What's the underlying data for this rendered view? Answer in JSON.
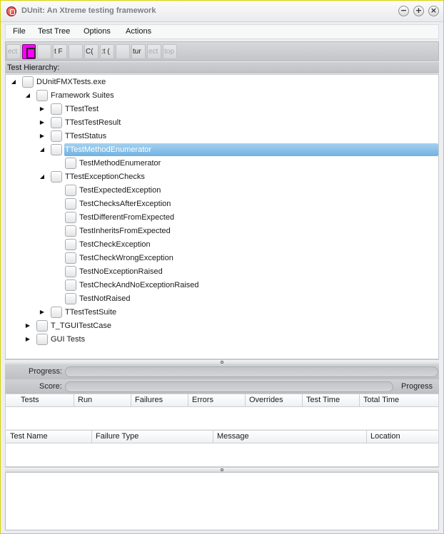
{
  "window": {
    "title": "DUnit: An Xtreme testing framework"
  },
  "menu": [
    "File",
    "Test Tree",
    "Options",
    "Actions"
  ],
  "toolbar": {
    "buttons": [
      {
        "label": "ect",
        "disabled": true
      },
      {
        "label": "",
        "icon": "magenta-select-icon"
      },
      {
        "label": ""
      },
      {
        "label": "t F"
      },
      {
        "label": ""
      },
      {
        "label": "C("
      },
      {
        "label": ":t ("
      },
      {
        "label": ""
      },
      {
        "label": "tur"
      },
      {
        "label": "ect",
        "disabled": true
      },
      {
        "label": "top",
        "disabled": true
      }
    ]
  },
  "hierarchy_label": "Test Hierarchy:",
  "tree": [
    {
      "label": "DUnitFMXTests.exe",
      "level": 0,
      "expander": "expanded"
    },
    {
      "label": "Framework Suites",
      "level": 1,
      "expander": "expanded"
    },
    {
      "label": "TTestTest",
      "level": 2,
      "expander": "collapsed"
    },
    {
      "label": "TTestTestResult",
      "level": 2,
      "expander": "collapsed"
    },
    {
      "label": "TTestStatus",
      "level": 2,
      "expander": "collapsed"
    },
    {
      "label": "TTestMethodEnumerator",
      "level": 2,
      "expander": "expanded",
      "selected": true
    },
    {
      "label": "TestMethodEnumerator",
      "level": 3,
      "expander": "none"
    },
    {
      "label": "TTestExceptionChecks",
      "level": 2,
      "expander": "expanded"
    },
    {
      "label": "TestExpectedException",
      "level": 3,
      "expander": "none"
    },
    {
      "label": "TestChecksAfterException",
      "level": 3,
      "expander": "none"
    },
    {
      "label": "TestDifferentFromExpected",
      "level": 3,
      "expander": "none"
    },
    {
      "label": "TestInheritsFromExpected",
      "level": 3,
      "expander": "none"
    },
    {
      "label": "TestCheckException",
      "level": 3,
      "expander": "none"
    },
    {
      "label": "TestCheckWrongException",
      "level": 3,
      "expander": "none"
    },
    {
      "label": "TestNoExceptionRaised",
      "level": 3,
      "expander": "none"
    },
    {
      "label": "TestCheckAndNoExceptionRaised",
      "level": 3,
      "expander": "none"
    },
    {
      "label": "TestNotRaised",
      "level": 3,
      "expander": "none"
    },
    {
      "label": "TTestTestSuite",
      "level": 2,
      "expander": "collapsed"
    },
    {
      "label": "T_TGUITestCase",
      "level": 1,
      "expander": "collapsed"
    },
    {
      "label": "GUI Tests",
      "level": 1,
      "expander": "collapsed"
    }
  ],
  "progress": {
    "progress_label": "Progress:",
    "score_label": "Score:",
    "progress_value": 0,
    "score_value": 0,
    "caption": "Progress"
  },
  "stats_columns": [
    "Tests",
    "Run",
    "Failures",
    "Errors",
    "Overrides",
    "Test Time",
    "Total Time"
  ],
  "failure_columns": [
    "Test Name",
    "Failure Type",
    "Message",
    "Location"
  ],
  "colors": {
    "selection": "#6fb2e2",
    "titlebar_border": "#d8d200"
  }
}
